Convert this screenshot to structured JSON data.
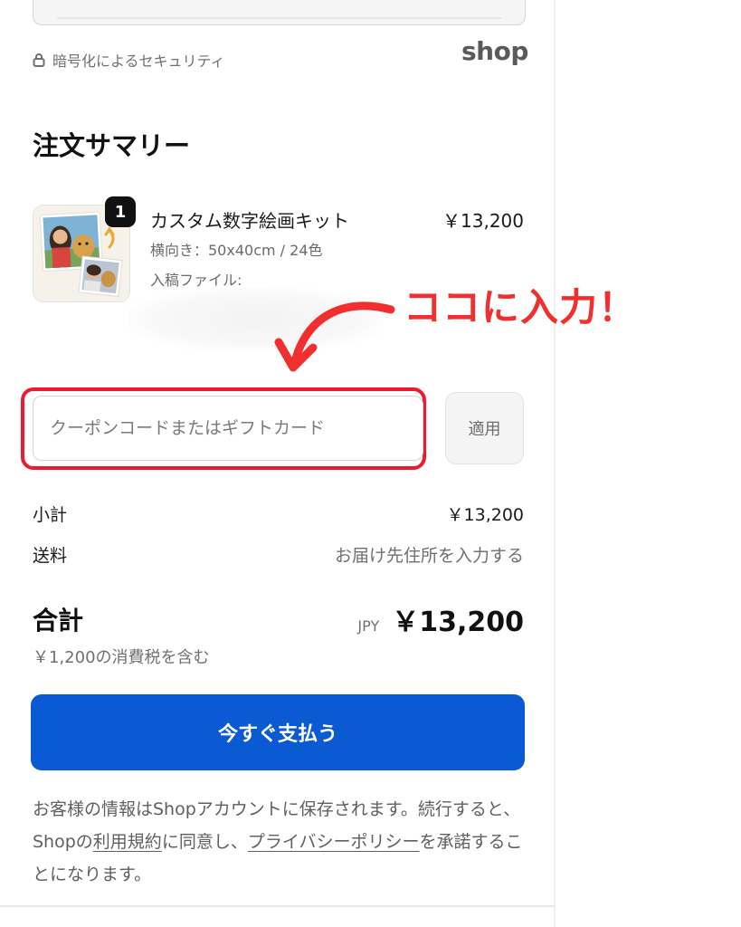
{
  "header": {
    "security_text": "暗号化によるセキュリティ",
    "shop_logo_text": "shop"
  },
  "summary": {
    "title": "注文サマリー",
    "item": {
      "quantity": "1",
      "name": "カスタム数字絵画キット",
      "variant": "横向き：50x40cm / 24色",
      "file_label": "入稿ファイル:",
      "price": "￥13,200"
    }
  },
  "annotation": {
    "text": "ココに入力！",
    "color": "#f22f2f"
  },
  "coupon": {
    "placeholder": "クーポンコードまたはギフトカード",
    "apply_label": "適用"
  },
  "rows": {
    "subtotal_label": "小計",
    "subtotal_value": "￥13,200",
    "shipping_label": "送料",
    "shipping_value": "お届け先住所を入力する"
  },
  "total": {
    "label": "合計",
    "currency": "JPY",
    "amount": "￥13,200",
    "tax_note": "￥1,200の消費税を含む"
  },
  "pay_button_label": "今すぐ支払う",
  "legal": {
    "part1": "お客様の情報はShopアカウントに保存されます。続行すると、Shopの",
    "terms_link": "利用規約",
    "part2": "に同意し、",
    "privacy_link": "プライバシーポリシー",
    "part3": "を承諾することになります。"
  },
  "colors": {
    "accent": "#0a5bd3",
    "highlight_red": "#ec1c2c"
  }
}
